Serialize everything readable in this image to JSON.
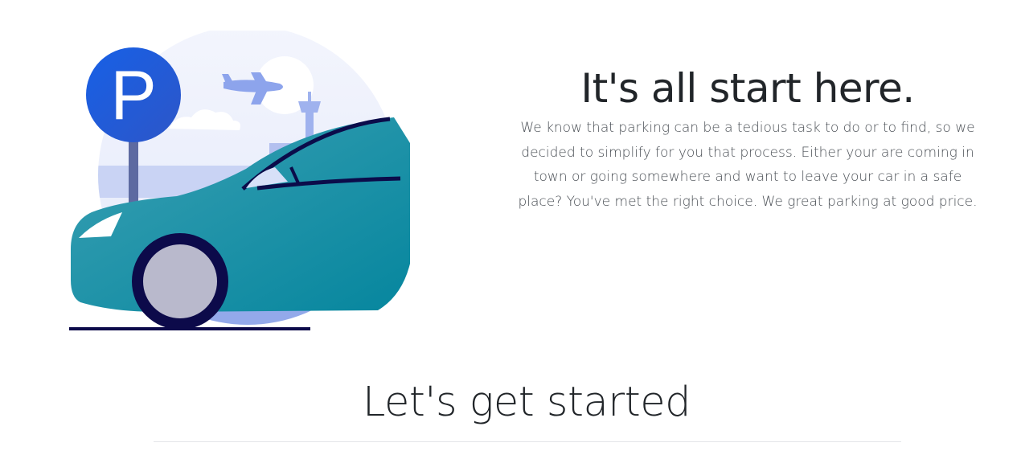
{
  "hero": {
    "title": "It's all start here.",
    "description": "We know that parking can be a tedious task to do or to find, so we decided to simplify for you that process. Either your are coming in town or going somewhere and want to leave your car in a safe place? You've met the right choice. We great parking at good price.",
    "illustration": {
      "icons": [
        "parking-sign-icon",
        "airplane-icon",
        "car-icon",
        "control-tower-icon"
      ],
      "sign_letter": "P"
    }
  },
  "section": {
    "heading": "Let's get started"
  },
  "colors": {
    "sign_blue": "#1b5fe0",
    "car_teal": "#1f8fa2",
    "tire_navy": "#0c0a4a",
    "sky_light": "#e9edfb",
    "airport_blue": "#b7c4ef",
    "text_dark": "#212529"
  }
}
